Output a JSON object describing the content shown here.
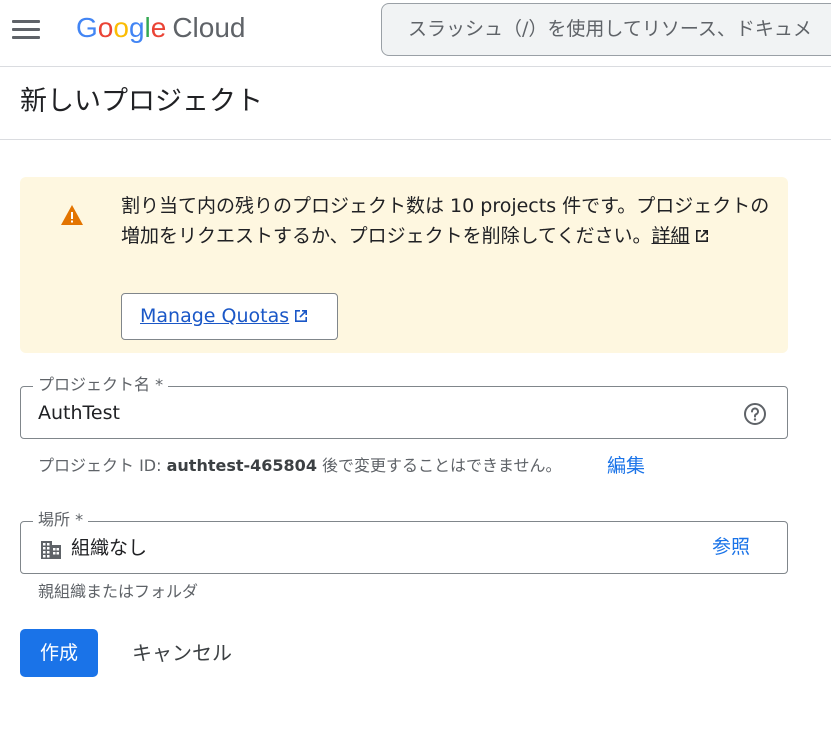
{
  "header": {
    "logo_google": "Google",
    "logo_cloud": "Cloud",
    "search_placeholder": "スラッシュ（/）を使用してリソース、ドキュメ"
  },
  "page": {
    "title": "新しいプロジェクト"
  },
  "quota_warning": {
    "text": "割り当て内の残りのプロジェクト数は 10 projects 件です。プロジェクトの増加をリクエストするか、プロジェクトを削除してください。",
    "learn_more": "詳細",
    "manage_quotas_label": "Manage Quotas"
  },
  "project_name": {
    "label": "プロジェクト名 *",
    "value": "AuthTest"
  },
  "project_id": {
    "prefix": "プロジェクト ID: ",
    "id": "authtest-465804",
    "suffix": " 後で変更することはできません。",
    "edit_label": "編集"
  },
  "location": {
    "label": "場所 *",
    "value": "組織なし",
    "browse_label": "参照",
    "hint": "親組織またはフォルダ"
  },
  "actions": {
    "create_label": "作成",
    "cancel_label": "キャンセル"
  },
  "colors": {
    "primary": "#1a73e8",
    "warning_bg": "#fef7e0",
    "warning_icon": "#e37400"
  }
}
